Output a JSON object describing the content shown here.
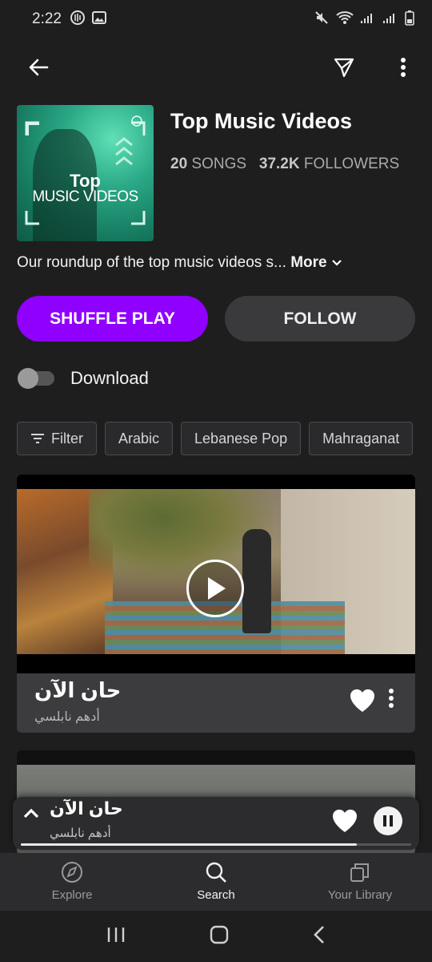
{
  "status_bar": {
    "time": "2:22"
  },
  "playlist": {
    "title": "Top Music Videos",
    "cover_top": "Top",
    "cover_sub": "MUSIC VIDEOS",
    "songs_count": "20",
    "songs_label": "SONGS",
    "followers_count": "37.2K",
    "followers_label": "FOLLOWERS",
    "description": "Our roundup of the top music videos s...",
    "more_label": "More"
  },
  "actions": {
    "shuffle_label": "SHUFFLE PLAY",
    "follow_label": "FOLLOW",
    "download_label": "Download",
    "download_enabled": false
  },
  "filters": {
    "filter_label": "Filter",
    "chips": [
      "Arabic",
      "Lebanese Pop",
      "Mahraganat"
    ]
  },
  "video_card": {
    "title": "حان الآن",
    "artist": "أدهم نابلسي"
  },
  "mini_player": {
    "title": "حان الآن",
    "artist": "أدهم نابلسي",
    "progress": 0.86
  },
  "bottom_nav": {
    "items": [
      {
        "label": "Explore",
        "icon": "compass-icon",
        "active": false
      },
      {
        "label": "Search",
        "icon": "search-icon",
        "active": true
      },
      {
        "label": "Your Library",
        "icon": "library-icon",
        "active": false
      }
    ]
  },
  "colors": {
    "accent": "#8f00ff",
    "background": "#1e1e1f",
    "surface": "#3c3c3e"
  }
}
